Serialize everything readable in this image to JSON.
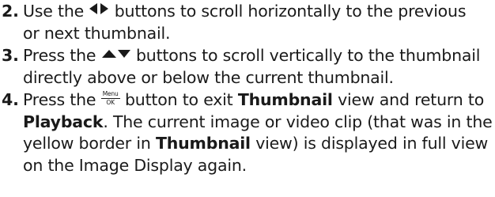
{
  "steps": [
    {
      "number": "2.",
      "line1_a": "Use the",
      "line1_b": "buttons to scroll horizontally to the previous",
      "line2": "or next thumbnail.",
      "icon": "left-right-arrow-icons"
    },
    {
      "number": "3.",
      "line1_a": "Press the",
      "line1_b": "buttons to scroll vertically to the thumbnail",
      "line2": "directly above or below the current thumbnail.",
      "icon": "up-down-arrow-icons"
    },
    {
      "number": "4.",
      "line1_a": "Press the",
      "menu_ok_top": "Menu",
      "menu_ok_bottom": "OK",
      "line1_b": "button to exit",
      "line1_bold": "Thumbnail",
      "line1_c": "view and return to",
      "line2_bold": "Playback",
      "line2": ". The current image or video clip (that was in the",
      "line3_a": "yellow border in",
      "line3_bold": "Thumbnail",
      "line3_b": "view) is displayed in full view",
      "line4": "on the Image Display again.",
      "icon": "menu-ok-icon"
    }
  ]
}
